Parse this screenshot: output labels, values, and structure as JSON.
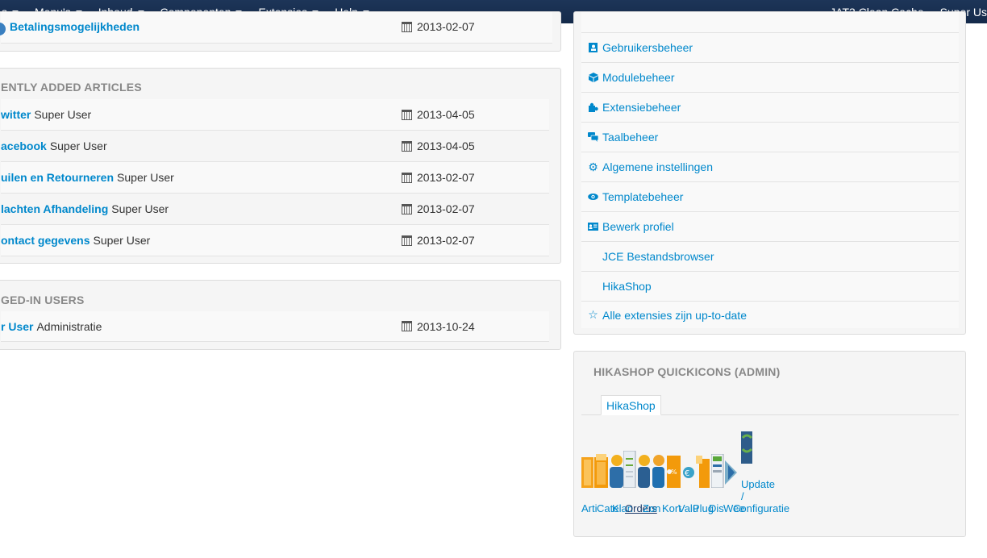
{
  "navbar": {
    "menu": [
      {
        "label": "s"
      },
      {
        "label": "Menu's"
      },
      {
        "label": "Inhoud"
      },
      {
        "label": "Componenten"
      },
      {
        "label": "Extensies"
      },
      {
        "label": "Help"
      }
    ],
    "right": [
      "JAT3 Clean Cache",
      "Super Us"
    ]
  },
  "top_partial_row": {
    "title": "Betalingsmogelijkheden",
    "date": "2013-02-07"
  },
  "recent_articles": {
    "header": "ENTLY ADDED ARTICLES",
    "rows": [
      {
        "title": "witter",
        "author": "Super User",
        "date": "2013-04-05"
      },
      {
        "title": "acebook",
        "author": "Super User",
        "date": "2013-04-05"
      },
      {
        "title": "uilen en Retourneren",
        "author": "Super User",
        "date": "2013-02-07"
      },
      {
        "title": "lachten Afhandeling",
        "author": "Super User",
        "date": "2013-02-07"
      },
      {
        "title": "ontact gegevens",
        "author": "Super User",
        "date": "2013-02-07"
      }
    ]
  },
  "logged_in": {
    "header": "GED-IN USERS",
    "rows": [
      {
        "title": "r User",
        "author": "Administratie",
        "date": "2013-10-24"
      }
    ]
  },
  "admin_links": [
    {
      "label": "Gebruikersbeheer",
      "icon": "users-icon"
    },
    {
      "label": "Modulebeheer",
      "icon": "cube-icon"
    },
    {
      "label": "Extensiebeheer",
      "icon": "puzzle-icon"
    },
    {
      "label": "Taalbeheer",
      "icon": "comments-icon"
    },
    {
      "label": "Algemene instellingen",
      "icon": "gear-icon"
    },
    {
      "label": "Templatebeheer",
      "icon": "eye-icon"
    },
    {
      "label": "Bewerk profiel",
      "icon": "profile-card-icon"
    },
    {
      "label": "JCE Bestandsbrowser",
      "icon": ""
    },
    {
      "label": "HikaShop",
      "icon": ""
    },
    {
      "label": "Alle extensies zijn up-to-date",
      "icon": "star-icon"
    }
  ],
  "hikashop": {
    "header": "HIKASHOP QUICKICONS (ADMIN)",
    "tab": "HikaShop",
    "labels": {
      "articles": "Arti",
      "categories": "Cate",
      "users": "Klan",
      "orders": "Orders",
      "zones": "Zon",
      "discounts": "Kort",
      "currencies": "Valu",
      "plugins": "Plug",
      "display": "Dis",
      "views": "Wee",
      "config": "Configuratie",
      "update_line1": "Update",
      "update_line2": "/"
    }
  },
  "colors": {
    "navbar": "#1b3254",
    "link": "#0088cc",
    "panel": "#f5f5f5"
  }
}
